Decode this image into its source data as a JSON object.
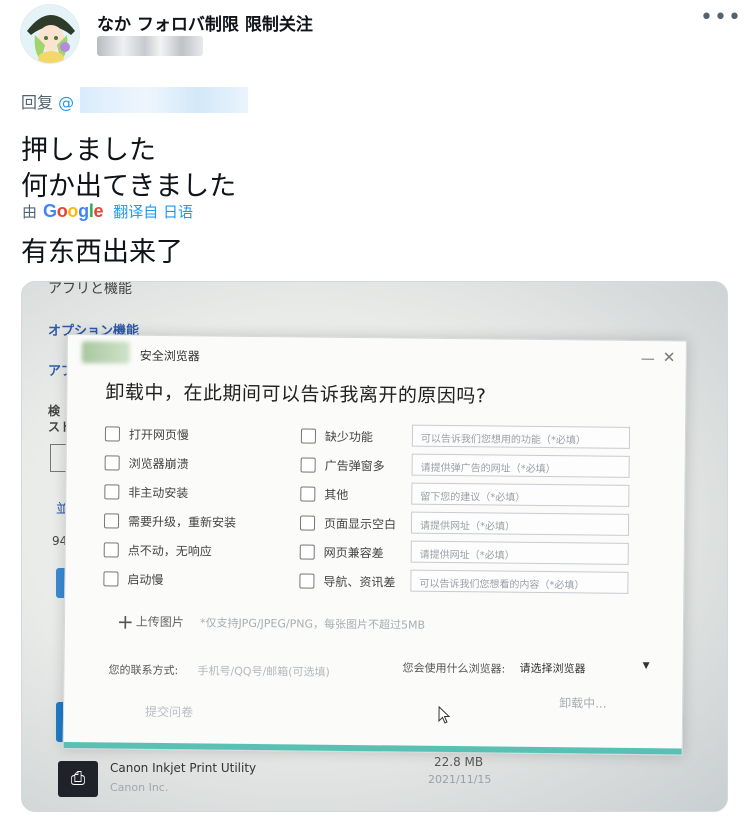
{
  "author": {
    "display_name": "なか フォロバ制限 限制关注",
    "more_label": "•••"
  },
  "reply": {
    "prefix": "回复",
    "mention": "@"
  },
  "tweet": {
    "line1": "押しました",
    "line2": "何か出てきました",
    "translated_by": "由",
    "translate_link": "翻译自 日语",
    "translation": "有东西出来了"
  },
  "screenshot": {
    "bg_texts": {
      "top_cut": "アフリと機能",
      "optional": "オプション機能",
      "side_a": "アプ",
      "side_b": "検",
      "side_c": "スト",
      "side_d": "並",
      "side_e": "94"
    },
    "dialog": {
      "title": "安全浏览器",
      "minimize": "—",
      "close": "✕",
      "heading": "卸载中，在此期间可以告诉我离开的原因吗?",
      "left_options": [
        "打开网页慢",
        "浏览器崩溃",
        "非主动安装",
        "需要升级，重新安装",
        "点不动，无响应",
        "启动慢"
      ],
      "right_options": [
        "缺少功能",
        "广告弹窗多",
        "其他",
        "页面显示空白",
        "网页兼容差",
        "导航、资讯差"
      ],
      "reason_placeholders": [
        "可以告诉我们您想用的功能（*必填）",
        "请提供弹广告的网址（*必填）",
        "留下您的建议（*必填）",
        "请提供网址（*必填）",
        "请提供网址（*必填）",
        "可以告诉我们您想看的内容（*必填）"
      ],
      "upload_label": "上传图片",
      "upload_hint": "*仅支持JPG/JPEG/PNG，每张图片不超过5MB",
      "contact_label": "您的联系方式:",
      "contact_placeholder": "手机号/QQ号/邮箱(可选填)",
      "browser_question": "您会使用什么浏览器:",
      "browser_select": "请选择浏览器",
      "submit": "提交问卷",
      "status": "卸载中..."
    },
    "app_row": {
      "name": "Canon Inkjet Print Utility",
      "vendor": "Canon Inc.",
      "size": "22.8 MB",
      "date": "2021/11/15"
    }
  }
}
